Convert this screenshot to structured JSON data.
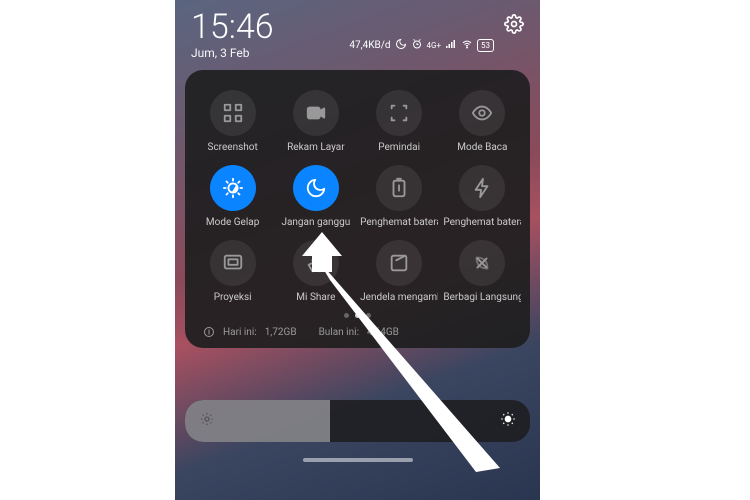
{
  "status": {
    "time": "15:46",
    "date": "Jum, 3 Feb",
    "data_rate": "47,4KB/d",
    "battery_pct": "53"
  },
  "tiles": [
    {
      "label": "Screenshot",
      "active": false,
      "icon": "screenshot"
    },
    {
      "label": "Rekam Layar",
      "active": false,
      "icon": "record"
    },
    {
      "label": "Pemindai",
      "active": false,
      "icon": "scan"
    },
    {
      "label": "Mode Baca",
      "active": false,
      "icon": "eye"
    },
    {
      "label": "Mode Gelap",
      "active": true,
      "icon": "darkmode"
    },
    {
      "label": "Jangan ganggu",
      "active": true,
      "icon": "moon"
    },
    {
      "label": "Penghemat baterai",
      "active": false,
      "icon": "battery"
    },
    {
      "label": "Penghemat baterai",
      "active": false,
      "icon": "bolt"
    },
    {
      "label": "Proyeksi",
      "active": false,
      "icon": "cast"
    },
    {
      "label": "Mi Share",
      "active": false,
      "icon": "mishare"
    },
    {
      "label": "Jendela mengambang",
      "active": false,
      "icon": "window"
    },
    {
      "label": "Berbagi Langsung",
      "active": false,
      "icon": "nearby"
    }
  ],
  "usage": {
    "today_label": "Hari ini:",
    "today_value": "1,72GB",
    "month_label": "Bulan ini:",
    "month_value": "4,64GB"
  },
  "brightness_pct": 38,
  "colors": {
    "accent": "#0a84ff"
  }
}
